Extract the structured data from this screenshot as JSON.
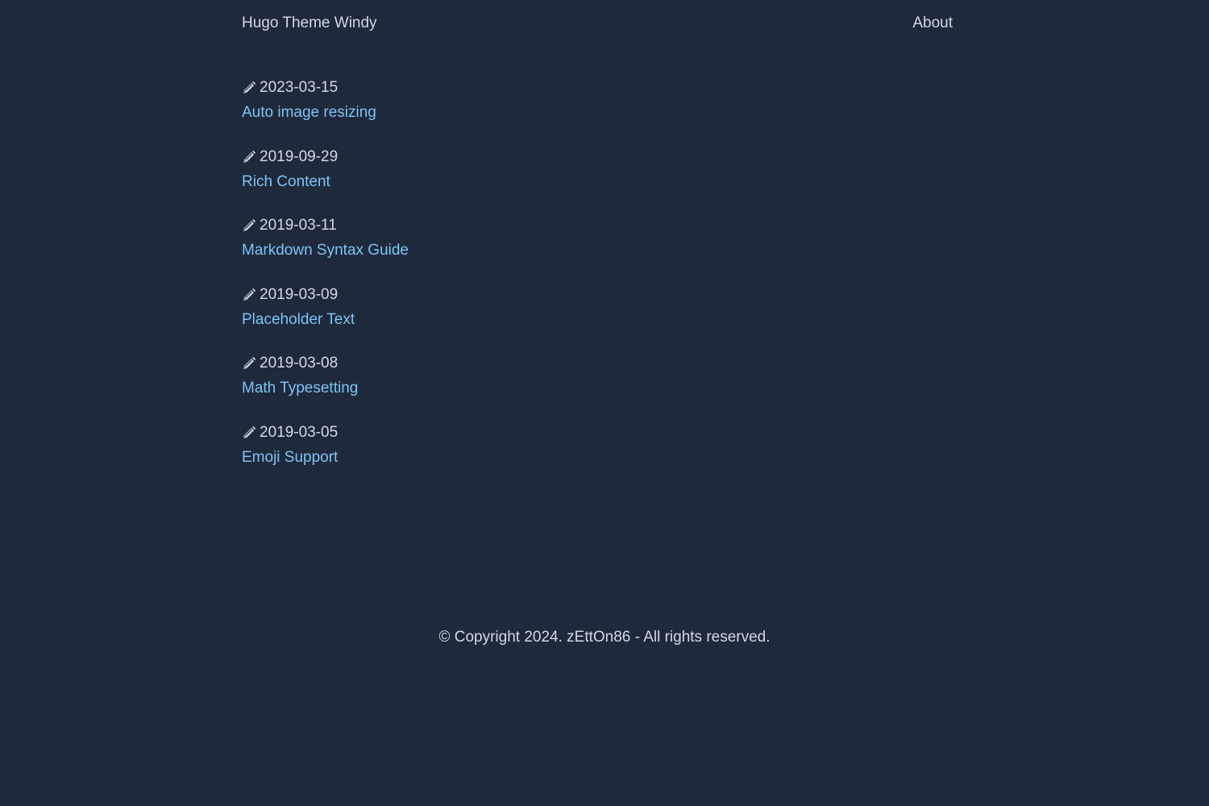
{
  "header": {
    "site_title": "Hugo Theme Windy",
    "nav": [
      {
        "label": "About"
      }
    ]
  },
  "posts": [
    {
      "date": "2023-03-15",
      "title": "Auto image resizing",
      "icon": "pencil-icon"
    },
    {
      "date": "2019-09-29",
      "title": "Rich Content",
      "icon": "pencil-icon"
    },
    {
      "date": "2019-03-11",
      "title": "Markdown Syntax Guide",
      "icon": "pencil-icon"
    },
    {
      "date": "2019-03-09",
      "title": "Placeholder Text",
      "icon": "pencil-icon"
    },
    {
      "date": "2019-03-08",
      "title": "Math Typesetting",
      "icon": "pencil-icon"
    },
    {
      "date": "2019-03-05",
      "title": "Emoji Support",
      "icon": "pencil-icon"
    }
  ],
  "footer": {
    "copyright": "© Copyright 2024. zEttOn86 - All rights reserved."
  },
  "colors": {
    "background": "#1f293c",
    "text": "#d4d8df",
    "link": "#7cc4f5"
  }
}
